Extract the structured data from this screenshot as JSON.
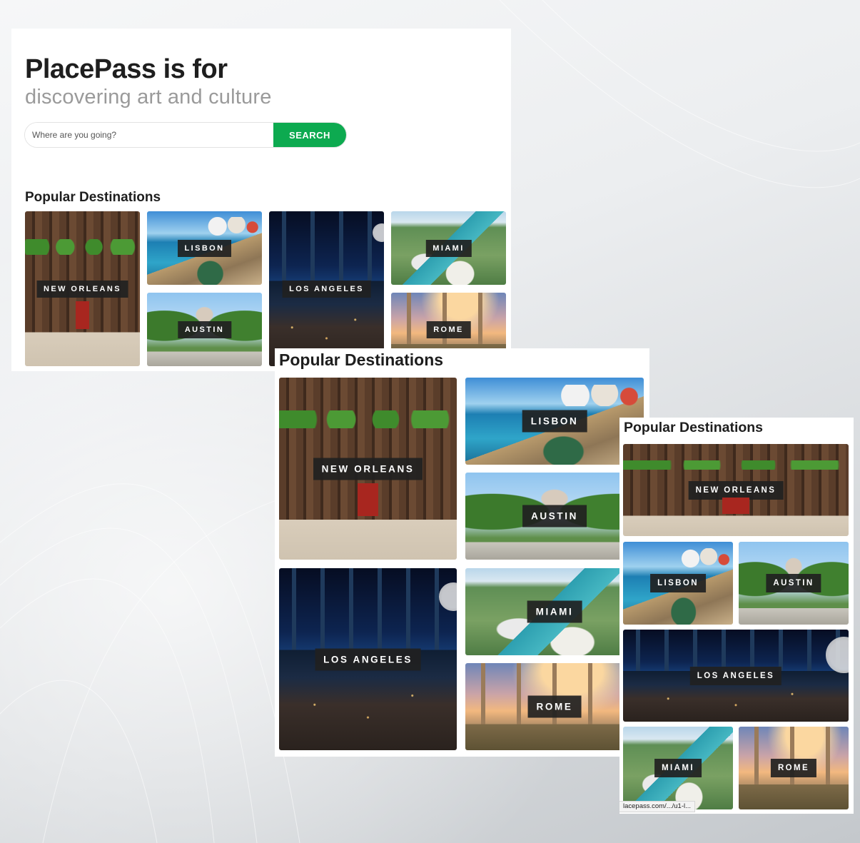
{
  "hero": {
    "title": "PlacePass is for",
    "subtitle": "discovering art and culture"
  },
  "search": {
    "placeholder": "Where are you going?",
    "button_label": "SEARCH",
    "button_color": "#0daa50"
  },
  "desktop": {
    "section_title": "Popular Destinations",
    "destinations": [
      "NEW ORLEANS",
      "LISBON",
      "AUSTIN",
      "LOS ANGELES",
      "MIAMI",
      "ROME"
    ]
  },
  "tablet": {
    "section_title": "Popular Destinations",
    "destinations": [
      "NEW ORLEANS",
      "LISBON",
      "AUSTIN",
      "LOS ANGELES",
      "MIAMI",
      "ROME"
    ]
  },
  "mobile": {
    "section_title": "Popular Destinations",
    "destinations": [
      "NEW ORLEANS",
      "LISBON",
      "AUSTIN",
      "LOS ANGELES",
      "MIAMI",
      "ROME"
    ],
    "status_url": "lacepass.com/.../u1-l..."
  }
}
